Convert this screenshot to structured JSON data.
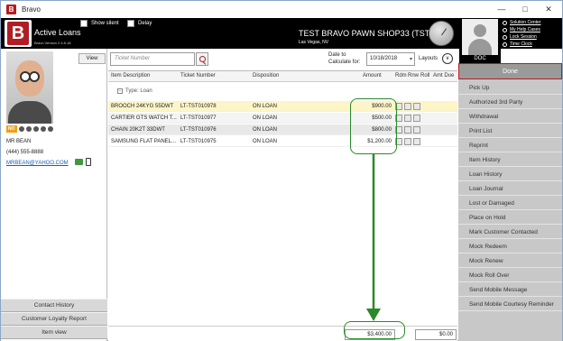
{
  "window": {
    "title": "Bravo"
  },
  "header": {
    "app_name": "Active Loans",
    "version": "Bravo Version 2.4.8.18",
    "show_silent_label": "Show silent",
    "delay_label": "Delay",
    "shop_name": "TEST BRAVO PAWN SHOP33 (TST)",
    "location": "Las Vegas, NV"
  },
  "user": {
    "name": "DOC"
  },
  "header_links": [
    "Solution Center",
    "My Help Cases",
    "Lock Session",
    "Time Clock"
  ],
  "customer": {
    "view_label": "View",
    "loyalty_badge": "NO",
    "name": "MR BEAN",
    "phone": "(444) 555-8888",
    "email": "MRBEAN@YAHOO.COM"
  },
  "left_buttons": [
    "Contact History",
    "Customer Loyalty Report",
    "Item view"
  ],
  "toolbar": {
    "ticket_placeholder": "Ticket Number",
    "date_label": "Date to Calculate for:",
    "date_value": "10/18/2018",
    "layouts_label": "Layouts"
  },
  "grid": {
    "columns": [
      "Item Description",
      "Ticket Number",
      "Disposition",
      "Amount",
      "Rdm",
      "Rnw",
      "Roll",
      "Amt Due"
    ],
    "group_label": "Type: Loan",
    "rows": [
      {
        "desc": "BROOCH 24KYG 55DWT",
        "ticket": "LT-TST010978",
        "disp": "ON LOAN",
        "amount": "$900.00"
      },
      {
        "desc": "CARTIER GTS WATCH T...",
        "ticket": "LT-TST010977",
        "disp": "ON LOAN",
        "amount": "$500.00"
      },
      {
        "desc": "CHAIN 20K2T 33DWT",
        "ticket": "LT-TST010976",
        "disp": "ON LOAN",
        "amount": "$800.00"
      },
      {
        "desc": "SAMSUNG FLAT PANEL...",
        "ticket": "LT-TST010975",
        "disp": "ON LOAN",
        "amount": "$1,200.00"
      }
    ],
    "total": "$3,400.00",
    "amt_due_total": "$0.00"
  },
  "actions": {
    "done_label": "Done",
    "items": [
      "Pick Up",
      "Authorized 3rd Party",
      "Withdrawal",
      "Print List",
      "Reprint",
      "Item History",
      "Loan History",
      "Loan Journal",
      "Lost or Damaged",
      "Place on Hold",
      "Mark Customer Contacted",
      "Mock Redeem",
      "Mock Renew",
      "Mock Roll Over",
      "Send Mobile Message",
      "Send Mobile Courtesy Reminder"
    ]
  },
  "colors": {
    "brand_red": "#b01e23",
    "highlight_row": "#fdf5c8",
    "callout_green": "#2a8a2a"
  }
}
